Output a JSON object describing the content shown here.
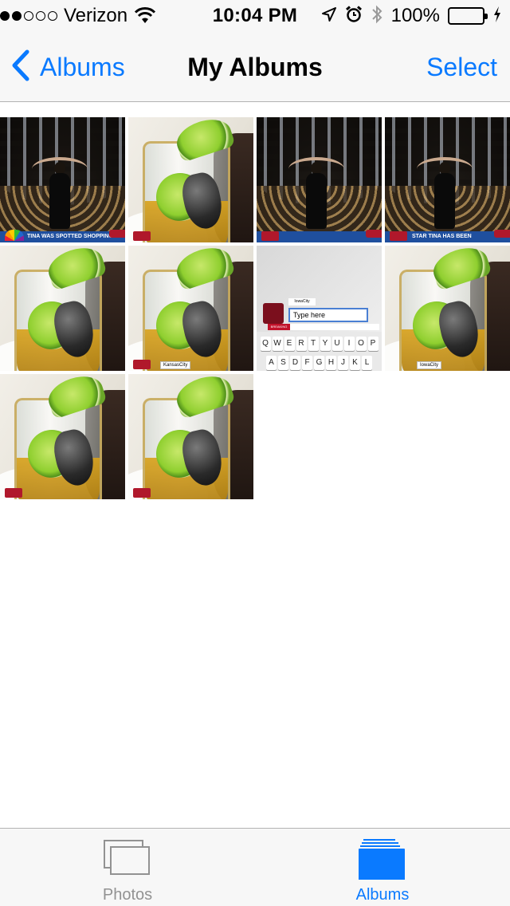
{
  "status_bar": {
    "carrier": "Verizon",
    "signal_bars_filled": 2,
    "signal_bars_total": 5,
    "time": "10:04 PM",
    "battery_percent": "100%",
    "icons": [
      "wifi-icon",
      "location-icon",
      "alarm-icon",
      "bluetooth-icon",
      "battery-icon",
      "charging-icon"
    ]
  },
  "nav": {
    "back_label": "Albums",
    "title": "My Albums",
    "select_label": "Select"
  },
  "thumbnails": [
    {
      "kind": "dome",
      "caption": "TINA WAS SPOTTED SHOPPING"
    },
    {
      "kind": "glass",
      "caption": ""
    },
    {
      "kind": "dome",
      "caption": ""
    },
    {
      "kind": "dome",
      "caption": "STAR TINA HAS BEEN"
    },
    {
      "kind": "glass",
      "caption": ""
    },
    {
      "kind": "glass",
      "caption": "KansasCity"
    },
    {
      "kind": "keyboard",
      "caption": ""
    },
    {
      "kind": "glass",
      "caption": "IowaCity"
    },
    {
      "kind": "glass",
      "caption": ""
    },
    {
      "kind": "glass",
      "caption": ""
    }
  ],
  "keyboard_shot": {
    "city": "IowaCity",
    "input_text": "Type here",
    "breaking_tag": "BREAKING",
    "row1": [
      "Q",
      "W",
      "E",
      "R",
      "T",
      "Y",
      "U",
      "I",
      "O",
      "P"
    ],
    "row2": [
      "A",
      "S",
      "D",
      "F",
      "G",
      "H",
      "J",
      "K",
      "L"
    ]
  },
  "tab_bar": {
    "photos_label": "Photos",
    "albums_label": "Albums",
    "active": "Albums",
    "accent_color": "#0a7aff",
    "inactive_color": "#929292"
  }
}
